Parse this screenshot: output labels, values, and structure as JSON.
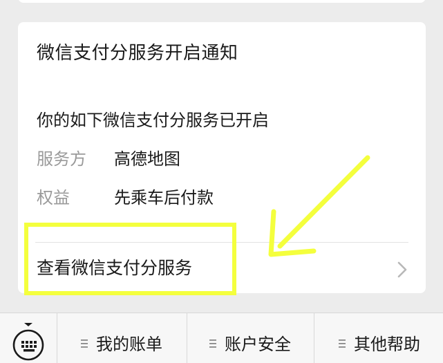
{
  "card": {
    "title": "微信支付分服务开启通知",
    "intro": "你的如下微信支付分服务已开启",
    "fields": [
      {
        "key": "服务方",
        "value": "高德地图"
      },
      {
        "key": "权益",
        "value": "先乘车后付款"
      }
    ],
    "link_label": "查看微信支付分服务"
  },
  "menu": {
    "items": [
      {
        "label": "我的账单"
      },
      {
        "label": "账户安全"
      },
      {
        "label": "其他帮助"
      }
    ]
  },
  "icons": {
    "keyboard": "keyboard-icon",
    "chevron": "chevron-right-icon",
    "menu_item": "submenu-lines-icon"
  },
  "colors": {
    "background": "#ececec",
    "card": "#ffffff",
    "label_gray": "#9a9a9a",
    "highlight_yellow": "#f4ff3d",
    "bottom_bar": "#f7f7f7"
  }
}
